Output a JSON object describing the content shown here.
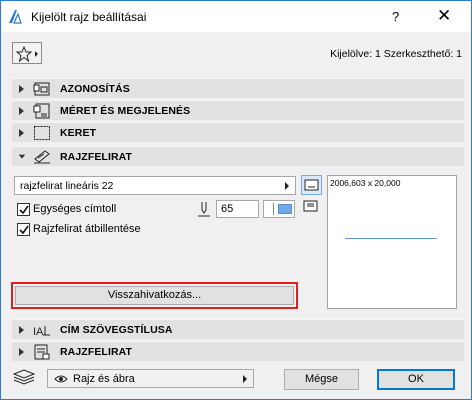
{
  "window": {
    "title": "Kijelölt rajz beállításai",
    "help_label": "?",
    "close_label": "✕",
    "accent": "#2b7bd6"
  },
  "toolbar": {
    "favorites_icon": "star-icon",
    "selection_info": "Kijelölve: 1 Szerkeszthető: 1"
  },
  "panels_top": [
    {
      "label": "AZONOSÍTÁS",
      "expanded": false,
      "icon": "id-icon"
    },
    {
      "label": "MÉRET ÉS MEGJELENÉS",
      "expanded": false,
      "icon": "size-appearance-icon"
    },
    {
      "label": "KERET",
      "expanded": false,
      "icon": "frame-icon"
    },
    {
      "label": "RAJZFELIRAT",
      "expanded": true,
      "icon": "title-icon"
    }
  ],
  "title_panel": {
    "type_value": "rajzfelirat lineáris 22",
    "uniform_text_label": "Egységes címtoll",
    "uniform_text_checked": true,
    "pen_value": "65",
    "pen_color": "#6fa8e8",
    "flip_label": "Rajzfelirat átbillentése",
    "flip_checked": true,
    "preview_size": "2006,603 x 20,000",
    "xref_button": "Visszahivatkozás..."
  },
  "panels_bottom": [
    {
      "label": "CÍM SZÖVEGSTÍLUSA",
      "expanded": false,
      "icon": "text-style-icon"
    },
    {
      "label": "RAJZFELIRAT",
      "expanded": false,
      "icon": "title-params-icon"
    }
  ],
  "footer": {
    "layer_value": "Rajz és ábra",
    "cancel_label": "Mégse",
    "ok_label": "OK"
  }
}
